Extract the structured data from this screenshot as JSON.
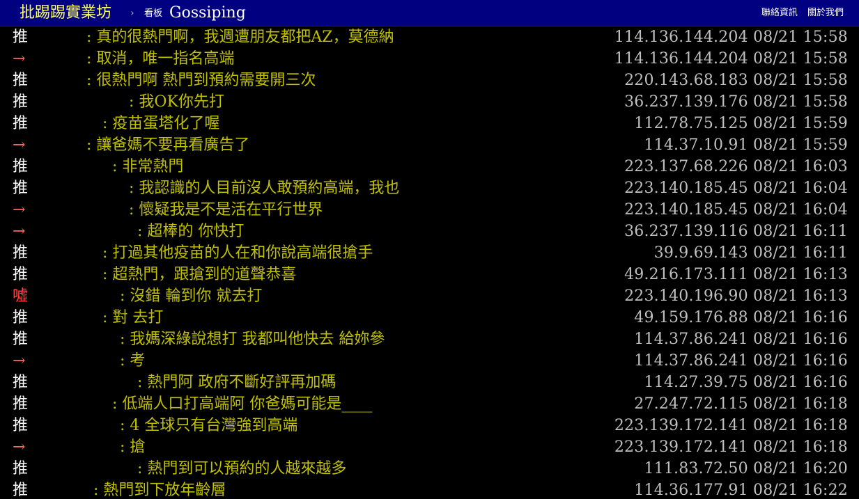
{
  "header": {
    "site_title": "批踢踢實業坊",
    "crumb_arrow": "›",
    "board_label": "看板",
    "board_name": "Gossiping",
    "nav": [
      "聯絡資訊",
      "關於我們"
    ]
  },
  "colors": {
    "header_bg": "#000080",
    "page_bg": "#000000",
    "push_good": "#ffffff",
    "push_neutral": "#ff6666",
    "push_bad": "#ff4444",
    "content_text": "#c0c000",
    "meta_text": "#c0c0c0"
  },
  "pushes": [
    {
      "tag": "推",
      "type": "good",
      "content": ": 真的很熱門啊，我週遭朋友都把AZ，莫德納",
      "meta": "114.136.144.204 08/21 15:58"
    },
    {
      "tag": "→",
      "type": "neutral",
      "content": ": 取消，唯一指名高端",
      "meta": "114.136.144.204 08/21 15:58"
    },
    {
      "tag": "推",
      "type": "good",
      "content": ": 很熱門啊 熱門到預約需要開三次",
      "meta": "220.143.68.183 08/21 15:58"
    },
    {
      "tag": "推",
      "type": "good",
      "content": ": 我OK你先打",
      "meta": "36.237.139.176 08/21 15:58"
    },
    {
      "tag": "推",
      "type": "good",
      "content": ": 疫苗蛋塔化了喔",
      "meta": "112.78.75.125 08/21 15:59"
    },
    {
      "tag": "→",
      "type": "neutral",
      "content": ": 讓爸媽不要再看廣告了",
      "meta": "114.37.10.91 08/21 15:59"
    },
    {
      "tag": "推",
      "type": "good",
      "content": ": 非常熱門",
      "meta": "223.137.68.226 08/21 16:03"
    },
    {
      "tag": "推",
      "type": "good",
      "content": ": 我認識的人目前沒人敢預約高端，我也",
      "meta": "223.140.185.45 08/21 16:04"
    },
    {
      "tag": "→",
      "type": "neutral",
      "content": ": 懷疑我是不是活在平行世界",
      "meta": "223.140.185.45 08/21 16:04"
    },
    {
      "tag": "→",
      "type": "neutral",
      "content": ": 超棒的 你快打",
      "meta": "36.237.139.116 08/21 16:11"
    },
    {
      "tag": "推",
      "type": "good",
      "content": ": 打過其他疫苗的人在和你說高端很搶手",
      "meta": "39.9.69.143 08/21 16:11"
    },
    {
      "tag": "推",
      "type": "good",
      "content": ": 超熱門，跟搶到的道聲恭喜",
      "meta": "49.216.173.111 08/21 16:13"
    },
    {
      "tag": "噓",
      "type": "bad",
      "content": ": 沒錯 輪到你 就去打",
      "meta": "223.140.196.90 08/21 16:13"
    },
    {
      "tag": "推",
      "type": "good",
      "content": ": 對 去打",
      "meta": "49.159.176.88 08/21 16:16"
    },
    {
      "tag": "推",
      "type": "good",
      "content": ": 我媽深綠說想打 我都叫他快去 給妳參",
      "meta": "114.37.86.241 08/21 16:16"
    },
    {
      "tag": "→",
      "type": "neutral",
      "content": ": 考",
      "meta": "114.37.86.241 08/21 16:16"
    },
    {
      "tag": "推",
      "type": "good",
      "content": ": 熱門阿 政府不斷好評再加碼",
      "meta": "114.27.39.75 08/21 16:16"
    },
    {
      "tag": "推",
      "type": "good",
      "content": ": 低端人口打高端阿 你爸媽可能是____",
      "meta": "27.247.72.115 08/21 16:18"
    },
    {
      "tag": "推",
      "type": "good",
      "content": ": 4 全球只有台灣強到高端",
      "meta": "223.139.172.141 08/21 16:18"
    },
    {
      "tag": "→",
      "type": "neutral",
      "content": ": 搶",
      "meta": "223.139.172.141 08/21 16:18"
    },
    {
      "tag": "推",
      "type": "good",
      "content": ": 熱門到可以預約的人越來越多",
      "meta": "111.83.72.50 08/21 16:20"
    },
    {
      "tag": "推",
      "type": "good",
      "content": ": 熱門到下放年齡層",
      "meta": "114.36.177.91 08/21 16:22"
    }
  ]
}
